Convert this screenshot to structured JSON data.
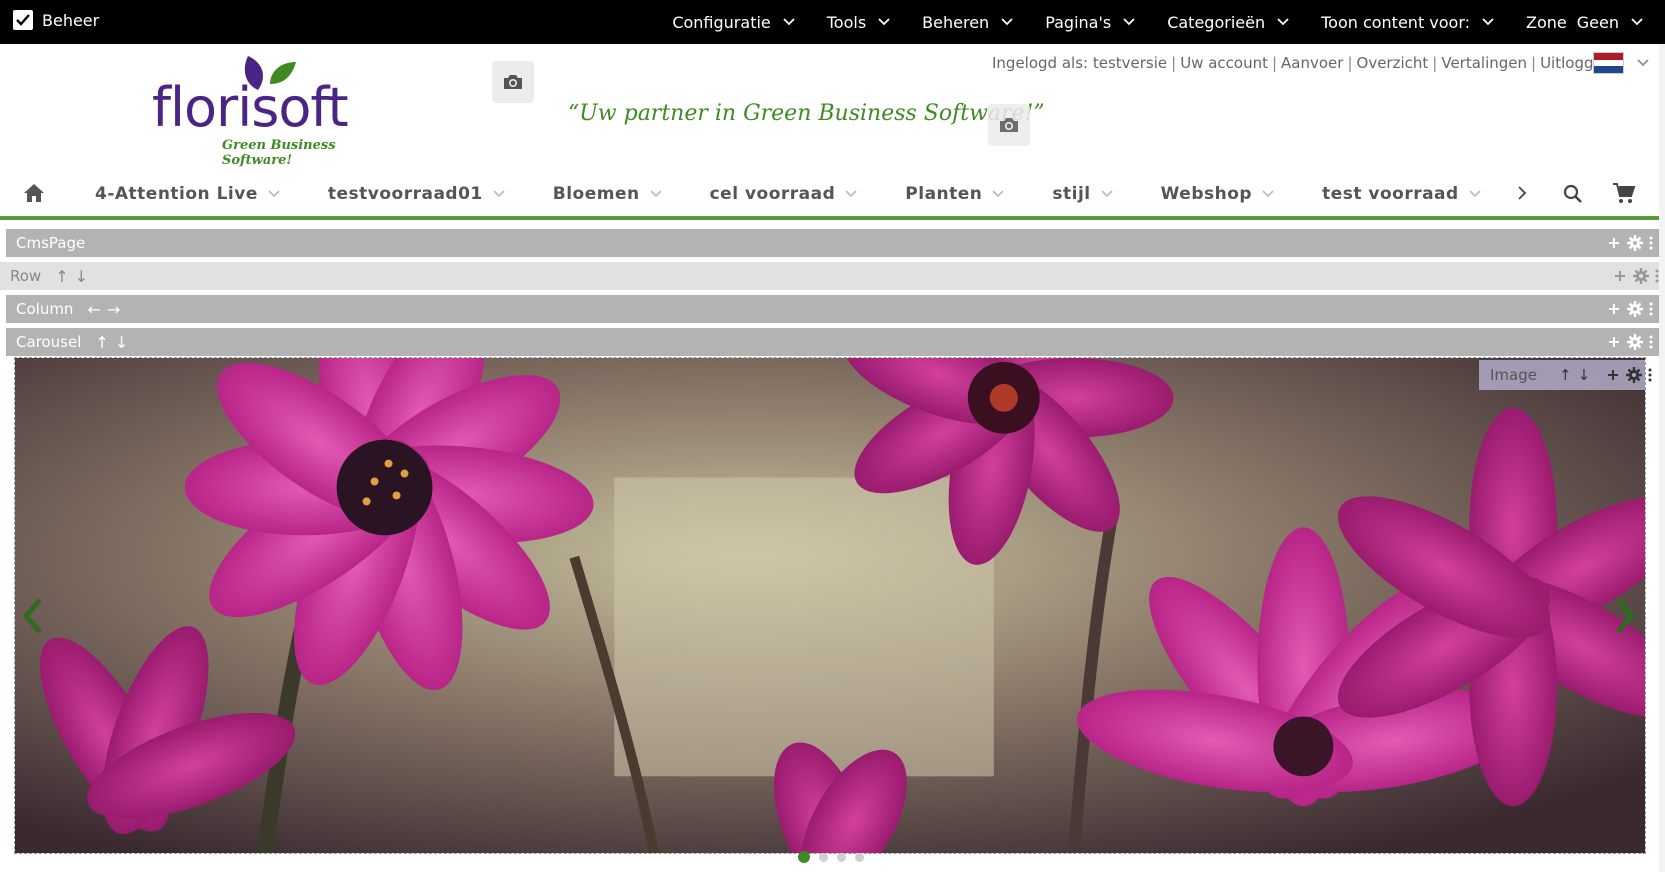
{
  "adminbar": {
    "beheer_label": "Beheer",
    "menu": [
      {
        "label": "Configuratie"
      },
      {
        "label": "Tools"
      },
      {
        "label": "Beheren"
      },
      {
        "label": "Pagina's"
      },
      {
        "label": "Categorieën"
      },
      {
        "label": "Toon content voor:"
      }
    ],
    "zone_label": "Zone",
    "zone_value": "Geen"
  },
  "header": {
    "logo_word": "florisoft",
    "logo_tagline": "Green Business Software!",
    "slogan": "“Uw partner in Green Business Software!”",
    "user_links": {
      "logged_in": "Ingelogd als: testversie",
      "account": "Uw account",
      "supply": "Aanvoer",
      "overview": "Overzicht",
      "translations": "Vertalingen",
      "logout": "Uitloggen"
    },
    "flag_colors": [
      "#ae1c28",
      "#ffffff",
      "#21468b"
    ]
  },
  "nav": {
    "items": [
      {
        "label": "4-Attention Live"
      },
      {
        "label": "testvoorraad01"
      },
      {
        "label": "Bloemen"
      },
      {
        "label": "cel voorraad"
      },
      {
        "label": "Planten"
      },
      {
        "label": "stijl"
      },
      {
        "label": "Webshop"
      },
      {
        "label": "test voorraad"
      },
      {
        "label": "V"
      }
    ],
    "accent_color": "#5a9a3a"
  },
  "editor": {
    "cmspage_label": "CmsPage",
    "row_label": "Row",
    "column_label": "Column",
    "carousel_label": "Carousel",
    "image_label": "Image"
  },
  "carousel": {
    "slide_count": 4,
    "active_slide": 1
  }
}
